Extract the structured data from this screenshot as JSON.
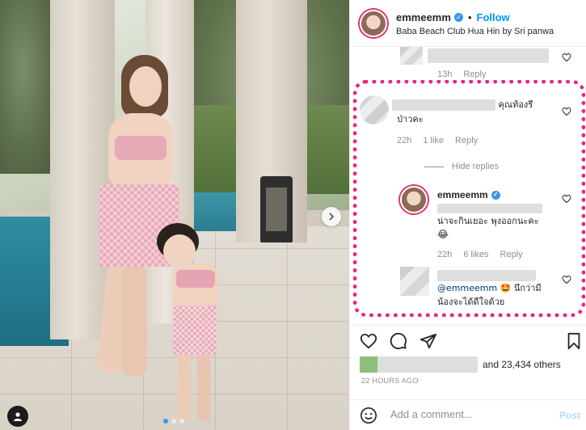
{
  "post": {
    "username": "emmeemm",
    "follow_label": "Follow",
    "separator": "•",
    "location": "Baba Beach Club Hua Hin by Sri panwa"
  },
  "comments": {
    "c0": {
      "time": "13h",
      "reply": "Reply"
    },
    "c1": {
      "suffix": "คุณท้องรึ",
      "line2": "ป่าวคะ",
      "time": "22h",
      "likes": "1 like",
      "reply": "Reply"
    },
    "hide_replies": "Hide replies",
    "r1": {
      "username": "emmeemm",
      "line2": "น่าจะกินเยอะ พุงออกนะคะ",
      "emoji": "😂",
      "time": "22h",
      "likes": "6 likes",
      "reply": "Reply"
    },
    "r2": {
      "mention": "@emmeemm",
      "emoji": "🤩",
      "text_after": "นึกว่ามี",
      "line2": "น้องจะได้ดีใจด้วย"
    }
  },
  "actions": {
    "likes_text": "and 23,434 others",
    "time_ago": "22 HOURS AGO"
  },
  "comment_box": {
    "placeholder": "Add a comment...",
    "post_label": "Post"
  },
  "colors": {
    "highlight": "#f0207f",
    "link": "#0095f6",
    "verified": "#3897f0"
  },
  "icons": [
    "verified-badge-icon",
    "heart-icon",
    "comment-icon",
    "share-icon",
    "bookmark-icon",
    "emoji-icon",
    "chevron-right-icon"
  ]
}
